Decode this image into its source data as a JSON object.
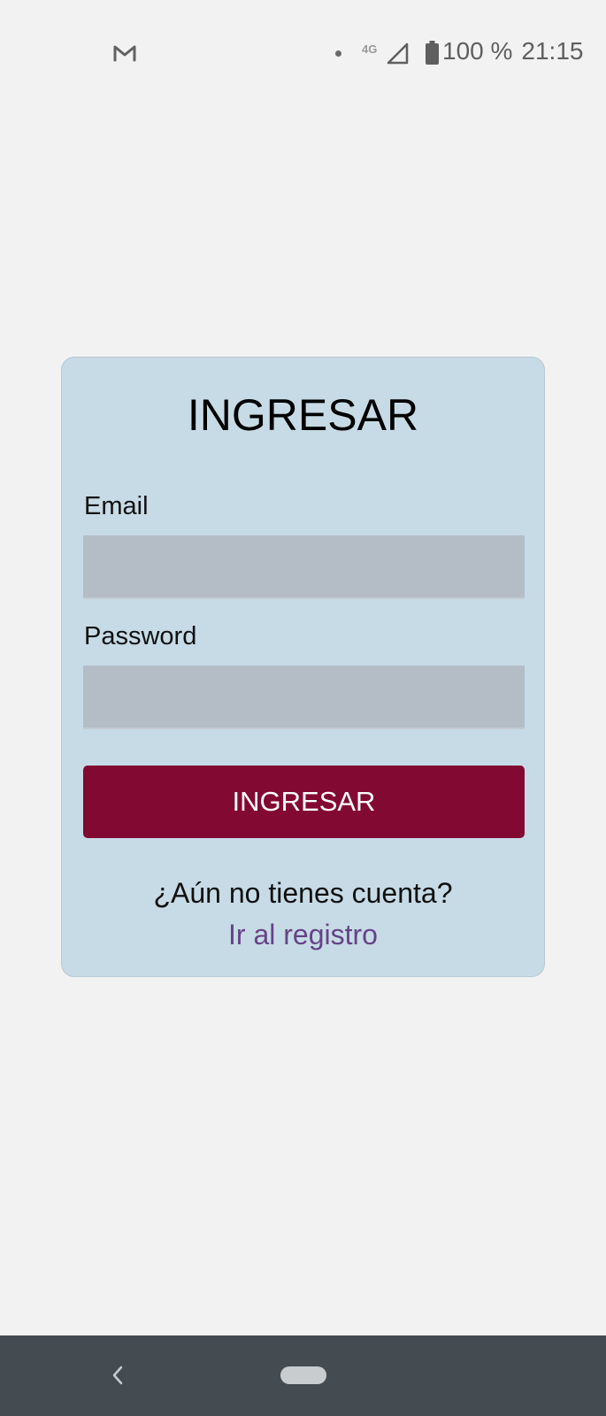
{
  "status_bar": {
    "notification_icon": "gmail-icon",
    "network_type": "4G",
    "signal_icon": "cell-signal-icon",
    "battery_icon": "battery-icon",
    "battery_percent": "100 %",
    "time": "21:15"
  },
  "login_card": {
    "title": "INGRESAR",
    "email_label": "Email",
    "email_value": "",
    "password_label": "Password",
    "password_value": "",
    "submit_label": "INGRESAR",
    "no_account_text": "¿Aún no tienes cuenta?",
    "register_link": "Ir al registro"
  },
  "nav_bar": {
    "back_icon": "back-chevron-icon",
    "home_icon": "home-pill-icon"
  },
  "colors": {
    "background": "#f2f2f2",
    "card_background": "#c7dbe6",
    "input_background": "#b4bdc6",
    "primary_button": "#820932",
    "link": "#654386",
    "nav_bar": "#444c52"
  }
}
